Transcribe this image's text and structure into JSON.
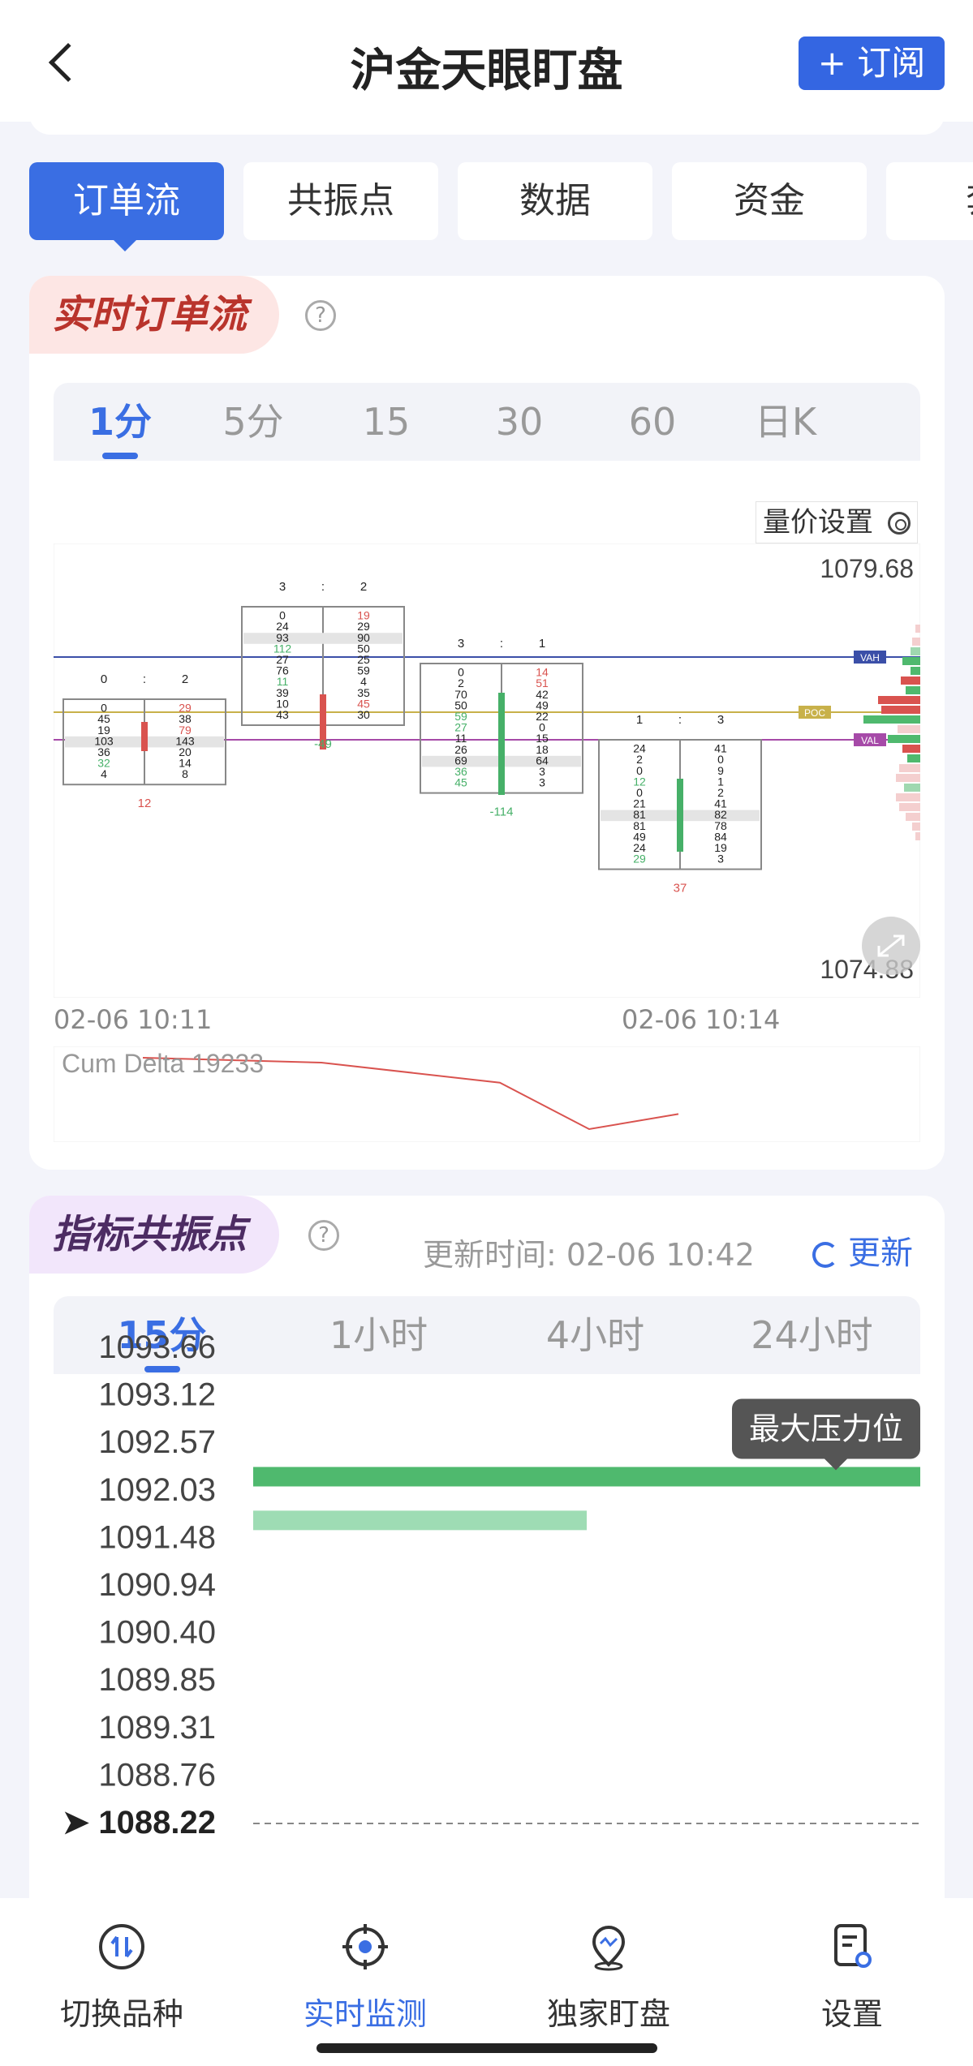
{
  "header": {
    "title": "沪金天眼盯盘",
    "subscribe_label": "+ 订阅"
  },
  "tabs": [
    "订单流",
    "共振点",
    "数据",
    "资金",
    "套"
  ],
  "orderflow": {
    "section_title": "实时订单流",
    "help_glyph": "?",
    "periods": [
      "1分",
      "5分",
      "15",
      "30",
      "60",
      "日K"
    ],
    "active_period": "1分",
    "settings_label": "量价设置",
    "price_high": "1079.68",
    "price_low": "1074.88",
    "level_labels": {
      "vah": "VAH",
      "poc": "POC",
      "val": "VAL"
    },
    "times": [
      "02-06 10:11",
      "02-06 10:14"
    ],
    "cum_delta_label": "Cum Delta 19233"
  },
  "chart_data": {
    "type": "footprint",
    "price_high": 1079.68,
    "price_low": 1074.88,
    "candles": [
      {
        "header": [
          "0",
          ":",
          "2"
        ],
        "bid": [
          "0",
          "45",
          "19",
          "103",
          "36",
          "32",
          "4"
        ],
        "ask": [
          "29",
          "38",
          "79",
          "143",
          "20",
          "14",
          "8"
        ],
        "delta": "12",
        "direction": "up"
      },
      {
        "header": [
          "3",
          ":",
          "2"
        ],
        "bid": [
          "0",
          "24",
          "93",
          "112",
          "27",
          "76",
          "11",
          "39",
          "10",
          "43"
        ],
        "ask": [
          "19",
          "29",
          "90",
          "50",
          "25",
          "59",
          "4",
          "35",
          "45",
          "30"
        ],
        "delta": "-49",
        "direction": "up"
      },
      {
        "header": [
          "3",
          ":",
          "1"
        ],
        "bid": [
          "0",
          "2",
          "70",
          "50",
          "59",
          "27",
          "11",
          "26",
          "69",
          "36",
          "45"
        ],
        "ask": [
          "14",
          "51",
          "42",
          "49",
          "22",
          "0",
          "15",
          "18",
          "64",
          "3",
          "3"
        ],
        "delta": "-114",
        "direction": "down"
      },
      {
        "header": [
          "1",
          ":",
          "3"
        ],
        "bid": [
          "24",
          "2",
          "0",
          "12",
          "0",
          "21",
          "81",
          "81",
          "49",
          "24",
          "29"
        ],
        "ask": [
          "41",
          "0",
          "9",
          "1",
          "2",
          "41",
          "82",
          "78",
          "84",
          "19",
          "3"
        ],
        "delta": "37",
        "direction": "down"
      }
    ],
    "cum_delta": [
      19233,
      19221,
      19172,
      19058,
      19095
    ]
  },
  "resonance": {
    "section_title": "指标共振点",
    "help_glyph": "?",
    "update_label": "更新时间: 02-06 10:42",
    "refresh_label": "更新",
    "periods": [
      "15分",
      "1小时",
      "4小时",
      "24小时"
    ],
    "active_period": "15分",
    "price_axis": [
      "1093.66",
      "1093.12",
      "1092.57",
      "1092.03",
      "1091.48",
      "1090.94",
      "1090.40",
      "1089.85",
      "1089.31",
      "1088.76",
      "➤ 1088.22"
    ],
    "tooltip": "最大压力位",
    "bars": [
      {
        "price": 1092.3,
        "strength": 1.0,
        "color": "#4fb96e"
      },
      {
        "price": 1091.8,
        "strength": 0.5,
        "color": "#9edcb4"
      }
    ]
  },
  "bottom_nav": {
    "items": [
      "切换品种",
      "实时监测",
      "独家盯盘",
      "设置"
    ],
    "active": "实时监测"
  },
  "colors": {
    "accent": "#3a6ee3",
    "up": "#d9534f",
    "down": "#46b068"
  }
}
